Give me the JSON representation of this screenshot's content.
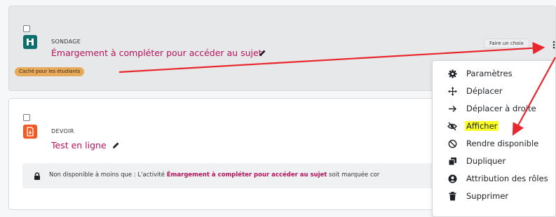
{
  "activities": [
    {
      "type_label": "SONDAGE",
      "title": "Émargement à compléter pour accéder au sujet",
      "badge": "Caché pour les étudiants",
      "action_button": "Faire un choix"
    },
    {
      "type_label": "DEVOIR",
      "title": "Test en ligne",
      "restriction_prefix": "Non disponible à moins que : L'activité ",
      "restriction_link": "Émargement à compléter pour accéder au sujet",
      "restriction_suffix": " soit marquée cor"
    }
  ],
  "menu": {
    "items": [
      {
        "label": "Paramètres",
        "icon": "gear-icon"
      },
      {
        "label": "Déplacer",
        "icon": "move-arrows-icon"
      },
      {
        "label": "Déplacer à droite",
        "icon": "arrow-right-icon"
      },
      {
        "label": "Afficher",
        "icon": "eye-slash-icon",
        "highlighted": true
      },
      {
        "label": "Rendre disponible",
        "icon": "ban-circle-icon"
      },
      {
        "label": "Dupliquer",
        "icon": "copy-icon"
      },
      {
        "label": "Attribution des rôles",
        "icon": "user-circle-icon"
      },
      {
        "label": "Supprimer",
        "icon": "trash-icon"
      }
    ]
  },
  "colors": {
    "link": "#b5125a",
    "badge_hidden": "#e7a95a",
    "survey_icon": "#0d6e6e",
    "assign_icon": "#f15a24",
    "highlight": "#fbff22",
    "annotation_arrow": "#e8262b"
  }
}
